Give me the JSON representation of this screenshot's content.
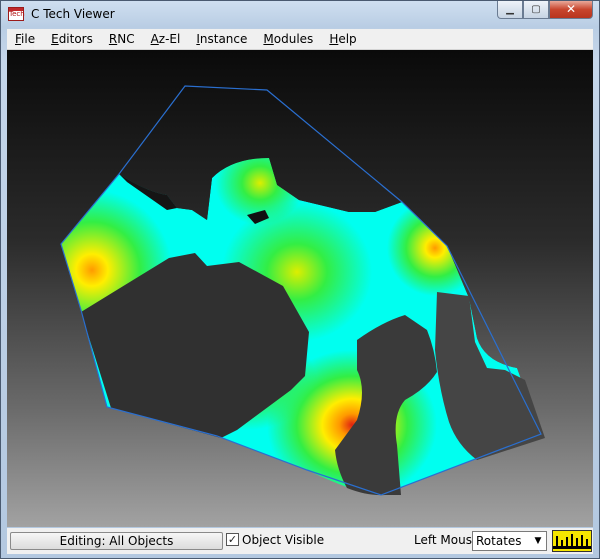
{
  "window": {
    "title": "C Tech Viewer",
    "app_icon_text": "Tech"
  },
  "caption_buttons": {
    "minimize": "▁",
    "maximize": "▢",
    "close": "✕"
  },
  "menu": [
    {
      "key": "F",
      "rest": "ile"
    },
    {
      "key": "E",
      "rest": "ditors"
    },
    {
      "key": "R",
      "rest": "NC"
    },
    {
      "key": "A",
      "rest": "z-El"
    },
    {
      "key": "I",
      "rest": "nstance"
    },
    {
      "key": "M",
      "rest": "odules"
    },
    {
      "key": "H",
      "rest": "elp"
    }
  ],
  "status": {
    "editing_label": "Editing: All Objects",
    "object_visible_label": "Object Visible",
    "object_visible_checked": true,
    "left_mouse_label": "Left Mouse",
    "left_mouse_value": "Rotates"
  },
  "colors": {
    "viewport_top": "#0a0a0a",
    "viewport_bottom": "#a2a2a2",
    "boundary_line": "#2a6fd0",
    "surface_low": "#00ffee",
    "surface_mid": "#33ee44",
    "surface_high": "#ffee00",
    "surface_peak": "#e02010",
    "meter": "#f5e600"
  }
}
